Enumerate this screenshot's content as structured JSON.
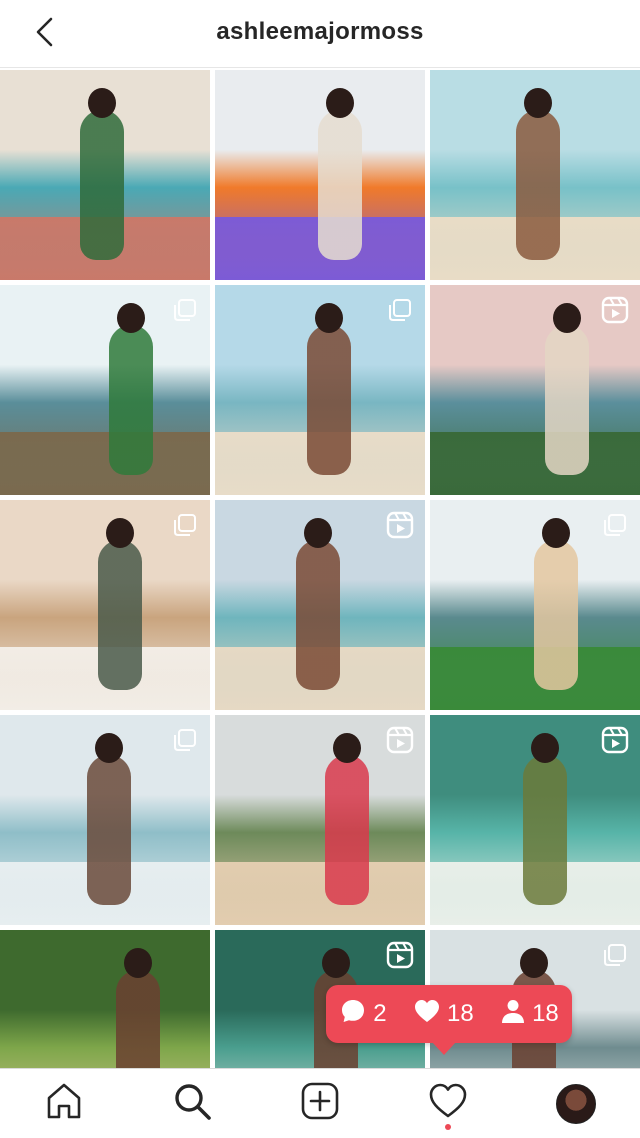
{
  "header": {
    "title": "ashleemajormoss"
  },
  "grid": {
    "posts": [
      {
        "type": "image",
        "scene": "pool-deck",
        "colors": [
          "#e8e0d4",
          "#4aa9b5",
          "#c9796a",
          "#2f6b3a"
        ]
      },
      {
        "type": "image",
        "scene": "lifeguard-tower",
        "colors": [
          "#e9ecef",
          "#f07a2a",
          "#7c5bd6",
          "#e6ddd0"
        ]
      },
      {
        "type": "image",
        "scene": "beach-walk",
        "colors": [
          "#b9dde4",
          "#78c1c8",
          "#e9dcc6",
          "#8a5a3e"
        ]
      },
      {
        "type": "carousel",
        "scene": "waterfall-boat",
        "colors": [
          "#e9f2f4",
          "#5a8e9a",
          "#7a6a4e",
          "#2f7a3a"
        ]
      },
      {
        "type": "carousel",
        "scene": "beach-portrait",
        "colors": [
          "#b5d9e8",
          "#79b6c2",
          "#e8dcc8",
          "#7a4a35"
        ]
      },
      {
        "type": "reel",
        "scene": "palm-sunset",
        "colors": [
          "#e6c9c5",
          "#5b8f9c",
          "#3a6a3a",
          "#e4d6c4"
        ]
      },
      {
        "type": "carousel",
        "scene": "arches-lounge",
        "colors": [
          "#ead8c6",
          "#c9a47e",
          "#f2ede6",
          "#4a5a4a"
        ]
      },
      {
        "type": "reel",
        "scene": "shore-walk",
        "colors": [
          "#c9d8e2",
          "#6fb5bd",
          "#e6d9c4",
          "#7a4a35"
        ]
      },
      {
        "type": "carousel",
        "scene": "waterfall-boat-2",
        "colors": [
          "#e9eff1",
          "#5a8a8e",
          "#3a8a3a",
          "#e4c7a0"
        ]
      },
      {
        "type": "carousel",
        "scene": "ocean-waves",
        "colors": [
          "#dfe8ec",
          "#8fbec8",
          "#e7eef0",
          "#6a4a3a"
        ]
      },
      {
        "type": "reel",
        "scene": "dune-path",
        "colors": [
          "#d8dcdc",
          "#6d8a5a",
          "#e3cdb0",
          "#d9394c"
        ]
      },
      {
        "type": "reel",
        "scene": "aerial-waterfall",
        "colors": [
          "#3f8d7e",
          "#57b4a8",
          "#e9efe9",
          "#6b7a3a"
        ]
      },
      {
        "type": "image",
        "scene": "jungle-portrait",
        "colors": [
          "#3e6a2e",
          "#7ea64a",
          "#e5ce9e",
          "#6a4030"
        ]
      },
      {
        "type": "reel",
        "scene": "lagoon-wade",
        "colors": [
          "#2a6a5a",
          "#4a9e8e",
          "#e9e6e0",
          "#6a4030"
        ]
      },
      {
        "type": "carousel",
        "scene": "waterfall-duo",
        "colors": [
          "#d9e1e3",
          "#6f8c8f",
          "#e9ede9",
          "#6a4030"
        ]
      }
    ]
  },
  "notification": {
    "comments": "2",
    "likes": "18",
    "follows": "18"
  },
  "tabbar": {
    "items": [
      "home",
      "search",
      "new-post",
      "activity",
      "profile"
    ]
  }
}
